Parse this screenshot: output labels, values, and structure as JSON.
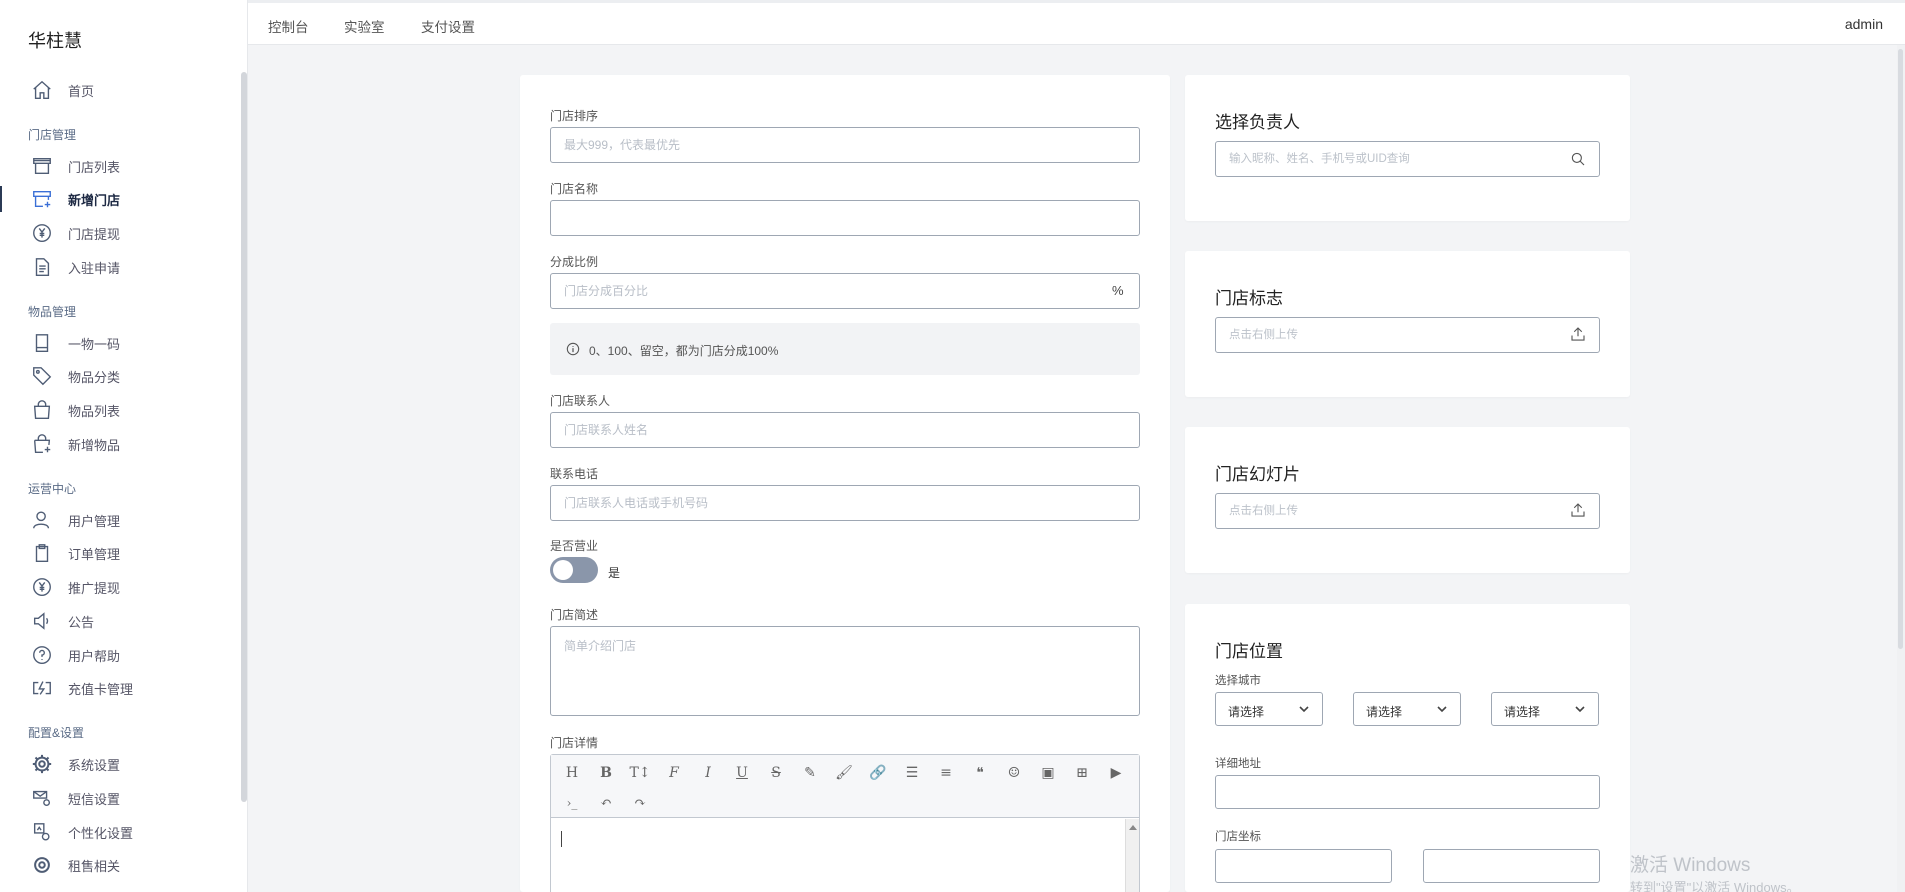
{
  "sidebar": {
    "brand": "华柱慧",
    "groups": [
      "门店管理",
      "物品管理",
      "运营中心",
      "配置&设置"
    ],
    "items": [
      {
        "label": "首页",
        "icon": "home-icon"
      },
      {
        "label": "门店列表",
        "icon": "store-icon"
      },
      {
        "label": "新增门店",
        "icon": "add-store-icon"
      },
      {
        "label": "门店提现",
        "icon": "yen-icon"
      },
      {
        "label": "入驻申请",
        "icon": "document-icon"
      },
      {
        "label": "一物一码",
        "icon": "book-icon"
      },
      {
        "label": "物品分类",
        "icon": "tag-icon"
      },
      {
        "label": "物品列表",
        "icon": "bag-icon"
      },
      {
        "label": "新增物品",
        "icon": "add-bag-icon"
      },
      {
        "label": "用户管理",
        "icon": "user-icon"
      },
      {
        "label": "订单管理",
        "icon": "clipboard-icon"
      },
      {
        "label": "推广提现",
        "icon": "yen-icon"
      },
      {
        "label": "公告",
        "icon": "speaker-icon"
      },
      {
        "label": "用户帮助",
        "icon": "help-icon"
      },
      {
        "label": "充值卡管理",
        "icon": "recharge-card-icon"
      },
      {
        "label": "系统设置",
        "icon": "gear-icon"
      },
      {
        "label": "短信设置",
        "icon": "sms-settings-icon"
      },
      {
        "label": "个性化设置",
        "icon": "personalize-icon"
      },
      {
        "label": "租售相关",
        "icon": "gear-icon"
      }
    ]
  },
  "topbar": {
    "tabs": [
      "控制台",
      "实验室",
      "支付设置"
    ],
    "user": "admin"
  },
  "form": {
    "sort": {
      "label": "门店排序",
      "placeholder": "最大999，代表最优先",
      "value": ""
    },
    "name": {
      "label": "门店名称",
      "placeholder": "",
      "value": ""
    },
    "ratio": {
      "label": "分成比例",
      "placeholder": "门店分成百分比",
      "suffix": "%"
    },
    "hint": "0、100、留空，都为门店分成100%",
    "contact": {
      "label": "门店联系人",
      "placeholder": "门店联系人姓名"
    },
    "phone": {
      "label": "联系电话",
      "placeholder": "门店联系人电话或手机号码"
    },
    "open": {
      "label": "是否营业",
      "state_label": "是"
    },
    "brief": {
      "label": "门店简述",
      "placeholder": "简单介绍门店"
    },
    "detail": {
      "label": "门店详情"
    },
    "toolbar": [
      "H",
      "B",
      "T↕",
      "F",
      "I",
      "U",
      "S",
      "✎",
      "🖌",
      "🔗",
      "☰",
      "≡",
      "❝",
      "☺",
      "▣",
      "⊞",
      "▶",
      "›_",
      "↶",
      "↷"
    ]
  },
  "owner_card": {
    "title": "选择负责人",
    "placeholder": "输入昵称、姓名、手机号或UID查询"
  },
  "logo_card": {
    "title": "门店标志",
    "placeholder": "点击右侧上传"
  },
  "slides_card": {
    "title": "门店幻灯片",
    "placeholder": "点击右侧上传"
  },
  "location_card": {
    "title": "门店位置",
    "city_label": "选择城市",
    "selects": [
      "请选择",
      "请选择",
      "请选择"
    ],
    "address_label": "详细地址",
    "coords_label": "门店坐标"
  },
  "watermark": {
    "line1": "激活 Windows",
    "line2": "转到\"设置\"以激活 Windows。"
  }
}
